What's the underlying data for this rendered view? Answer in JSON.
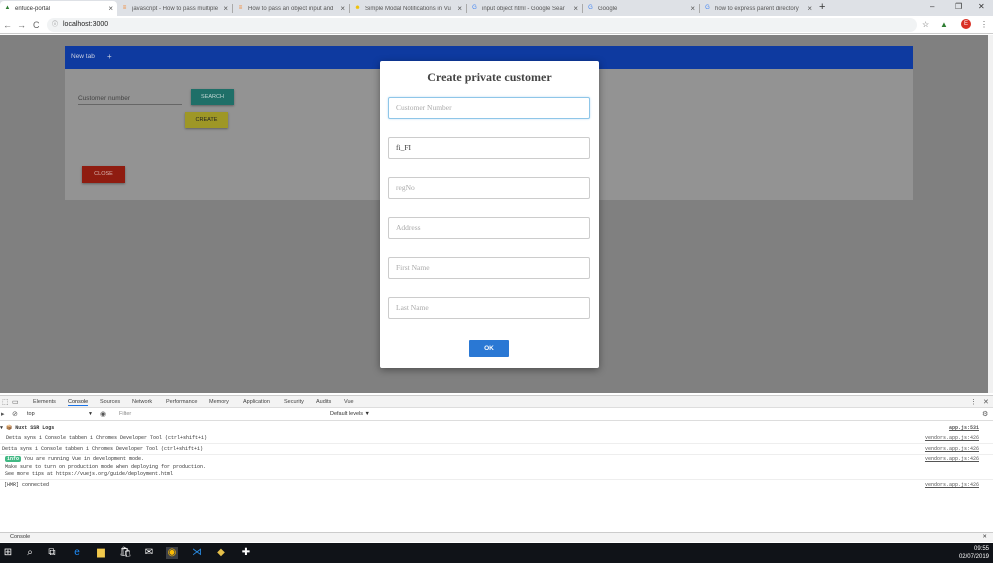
{
  "browser": {
    "tabs": [
      {
        "title": "enfuce-portal",
        "icon": "warning-triangle-icon",
        "color": "#2e7d32"
      },
      {
        "title": "javascript - How to pass multiple",
        "icon": "stackoverflow-icon",
        "color": "#f48024"
      },
      {
        "title": "How to pass an object input and",
        "icon": "stackoverflow-icon",
        "color": "#f48024"
      },
      {
        "title": "Simple Modal Notifications in Vu",
        "icon": "smiley-icon",
        "color": "#f0c000"
      },
      {
        "title": "input object html - Google Sear",
        "icon": "google-icon",
        "color": "#4285f4"
      },
      {
        "title": "Google",
        "icon": "google-icon",
        "color": "#4285f4"
      },
      {
        "title": "how to express parent directory",
        "icon": "google-icon",
        "color": "#4285f4"
      }
    ],
    "url": "localhost:3000",
    "new_tab_glyph": "+",
    "window_controls": [
      "–",
      "❐",
      "✕"
    ],
    "nav": {
      "back": "←",
      "forward": "→",
      "reload": "C"
    },
    "profile_initial": "E"
  },
  "app": {
    "tab_label": "New tab",
    "tab_add": "+",
    "customer_number_placeholder": "Customer number",
    "search_label": "SEARCH",
    "create_label": "CREATE",
    "close_label": "CLOSE"
  },
  "modal": {
    "title": "Create private customer",
    "fields": [
      {
        "placeholder": "Customer Number",
        "value": ""
      },
      {
        "placeholder": "",
        "value": "fi_FI"
      },
      {
        "placeholder": "regNo",
        "value": ""
      },
      {
        "placeholder": "Address",
        "value": ""
      },
      {
        "placeholder": "First Name",
        "value": ""
      },
      {
        "placeholder": "Last Name",
        "value": ""
      }
    ],
    "ok_label": "OK",
    "ok_color": "#2a78d4"
  },
  "devtools": {
    "tabs": [
      "Elements",
      "Console",
      "Sources",
      "Network",
      "Performance",
      "Memory",
      "Application",
      "Security",
      "Audits",
      "Vue"
    ],
    "active_tab": "Console",
    "context": "top",
    "filter_placeholder": "Filter",
    "levels": "Default levels ▼",
    "logs": [
      {
        "text": "▼ 📦 Nuxt SSR Logs",
        "source": "app.js:531"
      },
      {
        "text": "    Detta syns i Console tabben i Chromes Developer Tool (ctrl+shift+i)",
        "source": "vendors.app.js:426"
      },
      {
        "text": "  Detta syns i Console tabben i Chromes Developer Tool (ctrl+shift+i)",
        "source": "vendors.app.js:426"
      },
      {
        "badge": "info",
        "text": " You are running Vue in development mode.",
        "source": "vendors.app.js:426"
      },
      {
        "text": "Make sure to turn on production mode when deploying for production."
      },
      {
        "text": "See more tips at https://vuejs.org/guide/deployment.html"
      },
      {
        "text": "  [HMR] connected",
        "source": "vendors.app.js:426"
      }
    ],
    "drawer_label": "Console"
  },
  "taskbar": {
    "time": "09:55",
    "date": "02/07/2019"
  }
}
